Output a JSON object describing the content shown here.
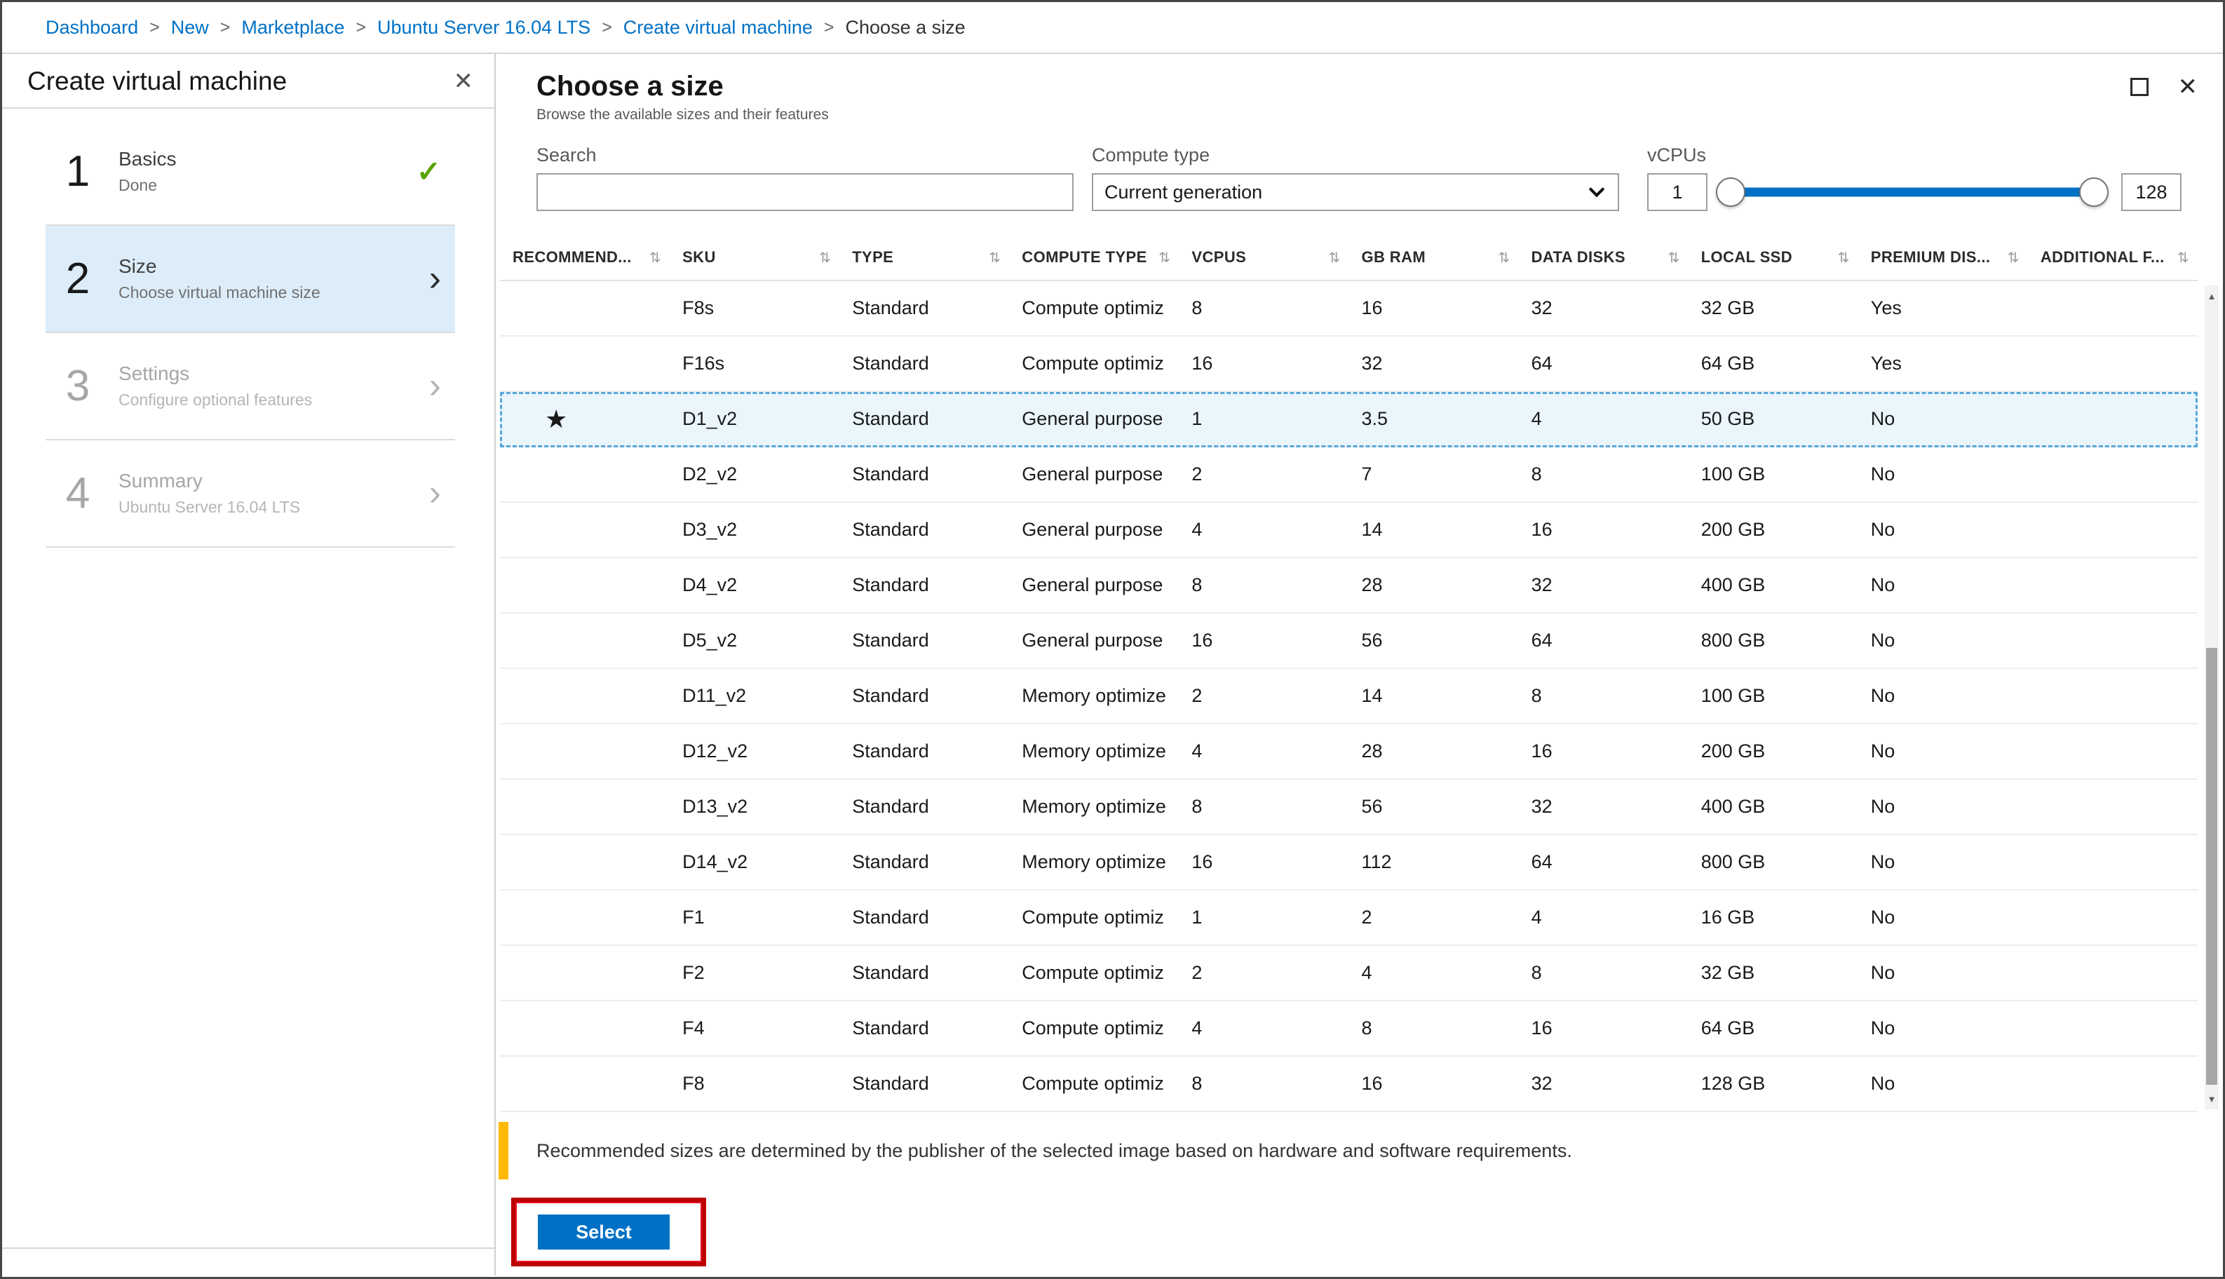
{
  "breadcrumb": {
    "separator": ">",
    "items": [
      "Dashboard",
      "New",
      "Marketplace",
      "Ubuntu Server 16.04 LTS",
      "Create virtual machine"
    ],
    "current": "Choose a size"
  },
  "icons": {
    "close": "✕",
    "check": "✓",
    "chevron_right": "›",
    "sort": "⇅",
    "star": "★",
    "scroll_up": "▲",
    "scroll_down": "▼"
  },
  "left_blade": {
    "title": "Create virtual machine",
    "steps": [
      {
        "number": "1",
        "title": "Basics",
        "subtitle": "Done",
        "state": "done"
      },
      {
        "number": "2",
        "title": "Size",
        "subtitle": "Choose virtual machine size",
        "state": "active"
      },
      {
        "number": "3",
        "title": "Settings",
        "subtitle": "Configure optional features",
        "state": "disabled"
      },
      {
        "number": "4",
        "title": "Summary",
        "subtitle": "Ubuntu Server 16.04 LTS",
        "state": "disabled"
      }
    ]
  },
  "size_blade": {
    "title": "Choose a size",
    "subtitle": "Browse the available sizes and their features",
    "filters": {
      "search_label": "Search",
      "search_value": "",
      "compute_type_label": "Compute type",
      "compute_type_value": "Current generation",
      "vcpus_label": "vCPUs",
      "vcpus_min": "1",
      "vcpus_max": "128"
    },
    "table": {
      "columns": [
        "RECOMMEND...",
        "SKU",
        "TYPE",
        "COMPUTE TYPE",
        "VCPUS",
        "GB RAM",
        "DATA DISKS",
        "LOCAL SSD",
        "PREMIUM DIS...",
        "ADDITIONAL F..."
      ],
      "rows": [
        {
          "recommended": "",
          "sku": "F8s",
          "type": "Standard",
          "compute_type": "Compute optimiz",
          "vcpus": "8",
          "gb_ram": "16",
          "data_disks": "32",
          "local_ssd": "32 GB",
          "premium_disk": "Yes",
          "additional": "",
          "selected": false
        },
        {
          "recommended": "",
          "sku": "F16s",
          "type": "Standard",
          "compute_type": "Compute optimiz",
          "vcpus": "16",
          "gb_ram": "32",
          "data_disks": "64",
          "local_ssd": "64 GB",
          "premium_disk": "Yes",
          "additional": "",
          "selected": false
        },
        {
          "recommended": "★",
          "sku": "D1_v2",
          "type": "Standard",
          "compute_type": "General purpose",
          "vcpus": "1",
          "gb_ram": "3.5",
          "data_disks": "4",
          "local_ssd": "50 GB",
          "premium_disk": "No",
          "additional": "",
          "selected": true
        },
        {
          "recommended": "",
          "sku": "D2_v2",
          "type": "Standard",
          "compute_type": "General purpose",
          "vcpus": "2",
          "gb_ram": "7",
          "data_disks": "8",
          "local_ssd": "100 GB",
          "premium_disk": "No",
          "additional": "",
          "selected": false
        },
        {
          "recommended": "",
          "sku": "D3_v2",
          "type": "Standard",
          "compute_type": "General purpose",
          "vcpus": "4",
          "gb_ram": "14",
          "data_disks": "16",
          "local_ssd": "200 GB",
          "premium_disk": "No",
          "additional": "",
          "selected": false
        },
        {
          "recommended": "",
          "sku": "D4_v2",
          "type": "Standard",
          "compute_type": "General purpose",
          "vcpus": "8",
          "gb_ram": "28",
          "data_disks": "32",
          "local_ssd": "400 GB",
          "premium_disk": "No",
          "additional": "",
          "selected": false
        },
        {
          "recommended": "",
          "sku": "D5_v2",
          "type": "Standard",
          "compute_type": "General purpose",
          "vcpus": "16",
          "gb_ram": "56",
          "data_disks": "64",
          "local_ssd": "800 GB",
          "premium_disk": "No",
          "additional": "",
          "selected": false
        },
        {
          "recommended": "",
          "sku": "D11_v2",
          "type": "Standard",
          "compute_type": "Memory optimize",
          "vcpus": "2",
          "gb_ram": "14",
          "data_disks": "8",
          "local_ssd": "100 GB",
          "premium_disk": "No",
          "additional": "",
          "selected": false
        },
        {
          "recommended": "",
          "sku": "D12_v2",
          "type": "Standard",
          "compute_type": "Memory optimize",
          "vcpus": "4",
          "gb_ram": "28",
          "data_disks": "16",
          "local_ssd": "200 GB",
          "premium_disk": "No",
          "additional": "",
          "selected": false
        },
        {
          "recommended": "",
          "sku": "D13_v2",
          "type": "Standard",
          "compute_type": "Memory optimize",
          "vcpus": "8",
          "gb_ram": "56",
          "data_disks": "32",
          "local_ssd": "400 GB",
          "premium_disk": "No",
          "additional": "",
          "selected": false
        },
        {
          "recommended": "",
          "sku": "D14_v2",
          "type": "Standard",
          "compute_type": "Memory optimize",
          "vcpus": "16",
          "gb_ram": "112",
          "data_disks": "64",
          "local_ssd": "800 GB",
          "premium_disk": "No",
          "additional": "",
          "selected": false
        },
        {
          "recommended": "",
          "sku": "F1",
          "type": "Standard",
          "compute_type": "Compute optimiz",
          "vcpus": "1",
          "gb_ram": "2",
          "data_disks": "4",
          "local_ssd": "16 GB",
          "premium_disk": "No",
          "additional": "",
          "selected": false
        },
        {
          "recommended": "",
          "sku": "F2",
          "type": "Standard",
          "compute_type": "Compute optimiz",
          "vcpus": "2",
          "gb_ram": "4",
          "data_disks": "8",
          "local_ssd": "32 GB",
          "premium_disk": "No",
          "additional": "",
          "selected": false
        },
        {
          "recommended": "",
          "sku": "F4",
          "type": "Standard",
          "compute_type": "Compute optimiz",
          "vcpus": "4",
          "gb_ram": "8",
          "data_disks": "16",
          "local_ssd": "64 GB",
          "premium_disk": "No",
          "additional": "",
          "selected": false
        },
        {
          "recommended": "",
          "sku": "F8",
          "type": "Standard",
          "compute_type": "Compute optimiz",
          "vcpus": "8",
          "gb_ram": "16",
          "data_disks": "32",
          "local_ssd": "128 GB",
          "premium_disk": "No",
          "additional": "",
          "selected": false
        }
      ]
    },
    "note": "Recommended sizes are determined by the publisher of the selected image based on hardware and software requirements.",
    "select_button": "Select"
  },
  "colors": {
    "accent_blue": "#0071c5",
    "selected_row_bg": "#eaf5fc",
    "active_step_bg": "#dcedf9",
    "annotation_red": "#bb0000",
    "note_accent": "#ffb900",
    "check_green": "#57a300"
  }
}
